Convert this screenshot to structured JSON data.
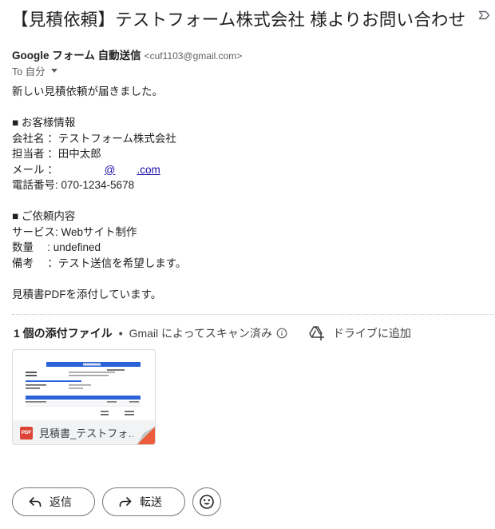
{
  "email": {
    "subject": "【見積依頼】テストフォーム株式会社 様よりお問い合わせ",
    "sender_name": "Google フォーム 自動送信",
    "sender_email": "<cuf1103@gmail.com>",
    "to_label": "To 自分",
    "body": {
      "intro": "新しい見積依頼が届きました。",
      "customer_heading": "■ お客様情報",
      "company_row": "会社名 ：テストフォーム株式会社",
      "person_row": "担当者 ：田中太郎",
      "mail_label": "メール ：",
      "mail_at": "@",
      "mail_domain": ".com",
      "phone_row": "電話番号: 070-1234-5678",
      "request_heading": "■ ご依頼内容",
      "service_row": "サービス: Webサイト制作",
      "quantity_row": "数量　 : undefined",
      "note_row": "備考　 ：テスト送信を希望します。",
      "closing": "見積書PDFを添付しています。"
    }
  },
  "attachments": {
    "count_label": "1 個の添付ファイル",
    "dot": "•",
    "scan_label": "Gmail によってスキャン済み",
    "drive_label": "ドライブに追加",
    "file": {
      "badge": "PDF",
      "name": "見積書_テストフォ…"
    }
  },
  "actions": {
    "reply": "返信",
    "forward": "転送"
  },
  "icons": {
    "label": "label-outline-icon",
    "info": "info-icon",
    "drive": "add-to-drive-icon",
    "reply": "reply-arrow-icon",
    "forward": "forward-arrow-icon",
    "emoji": "emoji-icon"
  },
  "colors": {
    "link": "#1a0dab",
    "pdf_red": "#db4437",
    "doc_header_blue": "#2b62d8"
  }
}
